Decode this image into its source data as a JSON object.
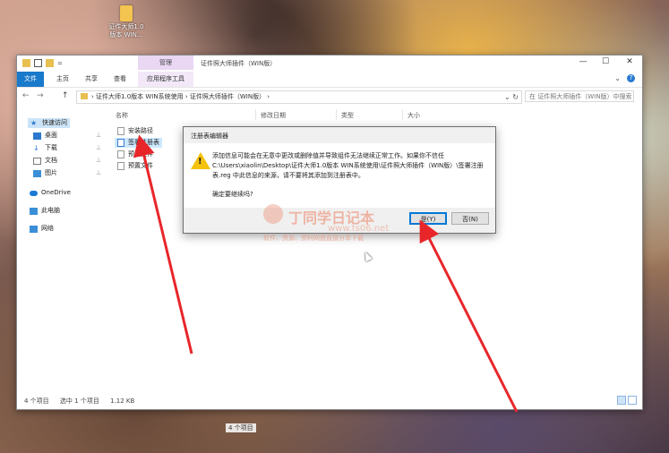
{
  "desktop": {
    "icon_label": "证件大师1.0\n版本 WIN..."
  },
  "window": {
    "quick_access_arrow": "=",
    "context_tab": "管理",
    "title": "证件照大师插件（WIN版）",
    "controls": {
      "minimize": "—",
      "maximize": "☐",
      "close": "✕"
    },
    "ribbon_tabs": [
      "文件",
      "主页",
      "共享",
      "查看",
      "应用程序工具"
    ],
    "help": "?",
    "ribbon_chevron": "⌄",
    "nav_back": "←",
    "nav_forward": "→",
    "nav_up": "↑",
    "address_sep": "›",
    "address_path": "›  证件大师1.0版本 WIN系统使用  ›  证件照大师插件（WIN版）  ›",
    "address_dropdown": "⌄  ↻",
    "search_placeholder": "在 证件照大师插件（WIN版）中搜索"
  },
  "sidebar": {
    "items": [
      {
        "label": "快速访问",
        "icon": "star-icon",
        "color": "#2b78d0",
        "pinned": false,
        "selected": true
      },
      {
        "label": "桌面",
        "icon": "desktop-icon",
        "color": "#2b78d0",
        "pinned": true,
        "selected": false
      },
      {
        "label": "下载",
        "icon": "download-icon",
        "color": "#2b78d0",
        "pinned": true,
        "selected": false
      },
      {
        "label": "文档",
        "icon": "document-icon",
        "color": "#7a7a7a",
        "pinned": true,
        "selected": false
      },
      {
        "label": "图片",
        "icon": "pictures-icon",
        "color": "#3b8fd6",
        "pinned": true,
        "selected": false
      },
      {
        "label": "OneDrive",
        "icon": "cloud-icon",
        "color": "#1a7ad4",
        "pinned": false,
        "selected": false
      },
      {
        "label": "此电脑",
        "icon": "computer-icon",
        "color": "#3b8fd6",
        "pinned": false,
        "selected": false
      },
      {
        "label": "网络",
        "icon": "network-icon",
        "color": "#3b8fd6",
        "pinned": false,
        "selected": false
      }
    ],
    "pin_glyph": "📌"
  },
  "columns": [
    "名称",
    "修改日期",
    "类型",
    "大小"
  ],
  "files": [
    {
      "name": "安装路径",
      "selected": false
    },
    {
      "name": "签署注册表",
      "selected": true
    },
    {
      "name": "预置文件",
      "selected": false
    },
    {
      "name": "预置文件",
      "selected": false
    }
  ],
  "status": {
    "count": "4 个项目",
    "selected": "选中 1 个项目",
    "size": "1.12 KB",
    "count_behind": "4 个项目"
  },
  "dialog": {
    "title": "注册表编辑器",
    "warning_glyph": "!",
    "message": "添加信息可能会在无意中更改或删除值并导致组件无法继续正常工作。如果你不信任 C:\\Users\\xiaolin\\Desktop\\证件大师1.0版本 WIN系统使用\\证件照大师插件（WIN版）\\签署注册表.reg 中此信息的来源，请不要将其添加到注册表中。",
    "question": "确定要继续吗?",
    "yes": "是(Y)",
    "no": "否(N)"
  },
  "watermark": {
    "title": "丁同学日记本",
    "site": "www.ts06.net",
    "sub": "软件、资源、资料网盘直接分享下载"
  },
  "colors": {
    "accent": "#1979ca",
    "arrow": "#e8262a",
    "selection": "#cce8ff",
    "warning": "#f4c20d"
  }
}
